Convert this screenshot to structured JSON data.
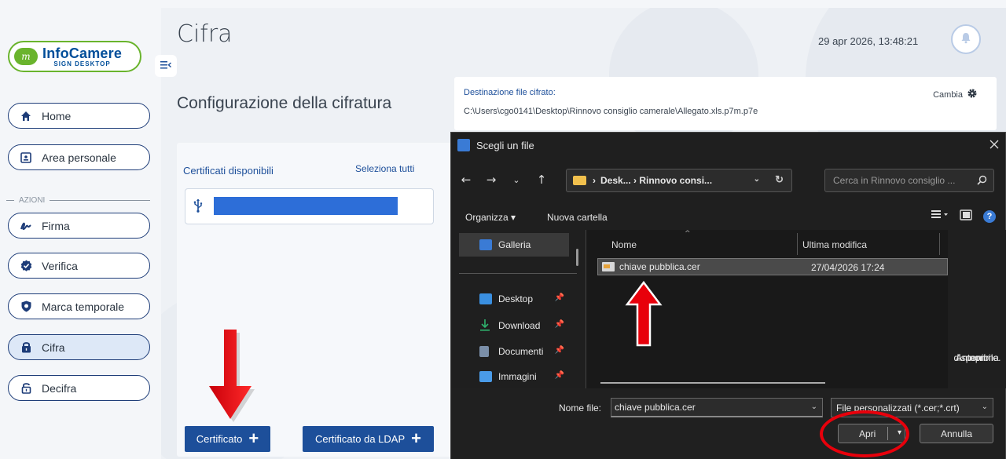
{
  "sidebar": {
    "logo": {
      "title": "InfoCamere",
      "subtitle": "SIGN DESKTOP",
      "mark": "m"
    },
    "items": [
      {
        "label": "Home",
        "icon": "home-icon"
      },
      {
        "label": "Area personale",
        "icon": "id-card-icon"
      },
      {
        "label": "Firma",
        "icon": "signature-icon"
      },
      {
        "label": "Verifica",
        "icon": "check-badge-icon"
      },
      {
        "label": "Marca temporale",
        "icon": "shield-icon"
      },
      {
        "label": "Cifra",
        "icon": "lock-icon",
        "active": true
      },
      {
        "label": "Decifra",
        "icon": "unlock-icon"
      }
    ],
    "section_label": "AZIONI"
  },
  "header": {
    "title": "Cifra",
    "datetime": "29 apr 2026, 13:48:21"
  },
  "main": {
    "subtitle": "Configurazione della cifratura",
    "destination": {
      "label": "Destinazione file cifrato:",
      "path": "C:\\Users\\cgo0141\\Desktop\\Rinnovo consiglio camerale\\Allegato.xls.p7m.p7e",
      "change_label": "Cambia"
    },
    "certificates": {
      "label": "Certificati disponibili",
      "select_all": "Seleziona tutti"
    },
    "buttons": {
      "certificate": "Certificato",
      "certificate_ldap": "Certificato da LDAP"
    }
  },
  "dialog": {
    "title": "Scegli un file",
    "address": "Desk... › Rinnovo consi...",
    "search_placeholder": "Cerca in Rinnovo consiglio ...",
    "toolbar": {
      "organize": "Organizza ▾",
      "new_folder": "Nuova cartella"
    },
    "sidebar": [
      {
        "label": "Galleria",
        "color": "#3a7bd5"
      },
      {
        "label": "Desktop",
        "color": "#3a8fe0"
      },
      {
        "label": "Download",
        "color": "#2fb36e"
      },
      {
        "label": "Documenti",
        "color": "#7a8ea8"
      },
      {
        "label": "Immagini",
        "color": "#4a9be8"
      }
    ],
    "columns": {
      "name": "Nome",
      "modified": "Ultima modifica"
    },
    "files": [
      {
        "name": "chiave pubblica.cer",
        "modified": "27/04/2026 17:24"
      }
    ],
    "preview": [
      "Anteprima",
      "non",
      "disponibile."
    ],
    "filename_label": "Nome file:",
    "filename_value": "chiave pubblica.cer",
    "filetype": "File personalizzati (*.cer;*.crt)",
    "open_label": "Apri",
    "cancel_label": "Annulla"
  },
  "colors": {
    "brand_blue": "#1d4f9a",
    "brand_green": "#6ab42d",
    "annotation_red": "#e8000b"
  }
}
